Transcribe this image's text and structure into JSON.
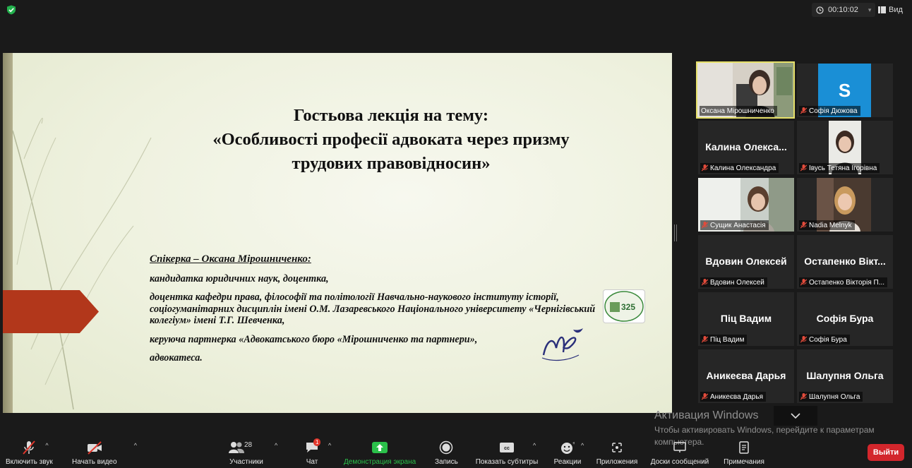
{
  "topbar": {
    "timer": "00:10:02",
    "view_label": "Вид"
  },
  "slide": {
    "title_line1": "Гостьова лекція на тему:",
    "title_line2": "«Особливості професії адвоката через призму",
    "title_line3": "трудових правовідносин»",
    "speaker": "Спікерка – Оксана Мірошниченко:",
    "lines": [
      "кандидатка юридичних наук, доцентка,",
      "доцентка кафедри права, філософії та політології Навчально-наукового інституту історії, соціогуманітарних дисциплін імені О.М. Лазаревського Національного університету «Чернігівський колегіум» імені Т.Г. Шевченка,",
      "керуюча партнерка «Адвокатського бюро «Мірошниченко та партнери»,",
      "адвокатеса."
    ],
    "logo_text": "325"
  },
  "participants": [
    {
      "name": "Оксана Мірошниченко",
      "big": "",
      "kind": "video",
      "muted": false
    },
    {
      "name": "Софія Дюжова",
      "big": "",
      "kind": "avatar",
      "initial": "S",
      "muted": true
    },
    {
      "name": "Калина Олександра",
      "big": "Калина Олекса...",
      "kind": "name",
      "muted": true
    },
    {
      "name": "Івусь Тетяна Ігорівна",
      "big": "",
      "kind": "video",
      "muted": true
    },
    {
      "name": "Сущик Анастасія",
      "big": "",
      "kind": "video",
      "muted": true
    },
    {
      "name": "Nadia Melnyk",
      "big": "",
      "kind": "video",
      "muted": true
    },
    {
      "name": "Вдовин Олексей",
      "big": "Вдовин Олексей",
      "kind": "name",
      "muted": true
    },
    {
      "name": "Остапенко Вікторія П...",
      "big": "Остапенко Вікт...",
      "kind": "name",
      "muted": true
    },
    {
      "name": "Піц Вадим",
      "big": "Піц Вадим",
      "kind": "name",
      "muted": true
    },
    {
      "name": "Софія Бура",
      "big": "Софія Бура",
      "kind": "name",
      "muted": true
    },
    {
      "name": "Аникеєва Дарья",
      "big": "Аникеєва Дарья",
      "kind": "name",
      "muted": true
    },
    {
      "name": "Шалупня Ольга",
      "big": "Шалупня Ольга",
      "kind": "name",
      "muted": true
    }
  ],
  "watermark": {
    "title": "Активация Windows",
    "text": "Чтобы активировать Windows, перейдите к параметрам компьютера."
  },
  "toolbar": {
    "unmute": "Включить звук",
    "start_video": "Начать видео",
    "participants": "Участники",
    "participants_count": "28",
    "chat": "Чат",
    "chat_badge": "1",
    "share": "Демонстрация экрана",
    "record": "Запись",
    "subtitles": "Показать субтитры",
    "reactions": "Реакции",
    "apps": "Приложения",
    "whiteboards": "Доски сообщений",
    "notes": "Примечания",
    "leave": "Выйти"
  },
  "colors": {
    "accent_green": "#2bc04a",
    "leave_red": "#d3262c",
    "active_speaker": "#e6e06a",
    "slide_arrow": "#b2371b"
  }
}
